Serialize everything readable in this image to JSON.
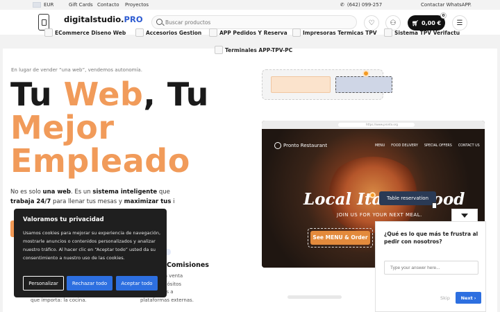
{
  "topbar": {
    "currency": "EUR",
    "links": [
      "Gift Cards",
      "Contacto",
      "Proyectos"
    ],
    "phone": "(642) 099-257",
    "whatsapp": "Contactar WhatsAPP."
  },
  "header": {
    "logo_main": "digitalstudio.",
    "logo_accent": "PRO",
    "search_placeholder": "Buscar productos",
    "cart_total": "0,00 €",
    "cart_count": "0"
  },
  "categories": [
    "ECommerce Diseno Web",
    "Accesorios Gestion",
    "APP Pedidos Y Reserva",
    "Impresoras Termicas TPV",
    "Sistema TPV Verifactu",
    "Terminales APP-TPV-PC"
  ],
  "hero": {
    "eyebrow": "En lugar de vender “una web”, vendemos autonomía.",
    "line1_a": "Tu ",
    "line1_b": "Web",
    "line1_c": ", Tu",
    "line2": "Mejor",
    "line3": "Empleado",
    "para_1": "No es solo ",
    "para_2": "una web",
    "para_3": ". Es un ",
    "para_4": "sistema inteligente",
    "para_5": " que ",
    "para_6": "trabaja 24/7",
    "para_7": " para llenar tus mesas y ",
    "para_8": "maximizar tus",
    "para_9": " i"
  },
  "features": {
    "f2_title": "Comisiones",
    "f2_text": "sita en una venta\nagos y depósitos\nporcentajes a\nplataformas externas.",
    "f1_text": "que importa: la cocina."
  },
  "preview": {
    "url": "https://www.pronto.org",
    "restaurant": "Pronto Restaurant",
    "nav": [
      "MENU",
      "FOOD DELIVERY",
      "SPECIAL OFFERS",
      "CONTACT US"
    ],
    "headline": "Local Italian Food",
    "subline": "JOIN US FOR YOUR NEXT MEAL.",
    "menu_button": "See MENU & Order",
    "tooltip": "Table reservation"
  },
  "cookie": {
    "title": "Valoramos tu privacidad",
    "text": "Usamos cookies para mejorar su experiencia de navegación, mostrarle anuncios o contenidos personalizados y analizar nuestro tráfico. Al hacer clic en “Aceptar todo” usted da su consentimiento a nuestro uso de las cookies.",
    "customize": "Personalizar",
    "reject": "Rechazar todo",
    "accept": "Aceptar todo"
  },
  "chat": {
    "question": "¿Qué es lo que más te frustra al pedir con nosotros?",
    "answer_placeholder": "Type your answer here...",
    "skip": "Skip",
    "next": "Next"
  },
  "colors": {
    "accent_orange": "#f19b5a",
    "brand_blue": "#2d5bd1",
    "button_blue": "#2d6fe0"
  }
}
